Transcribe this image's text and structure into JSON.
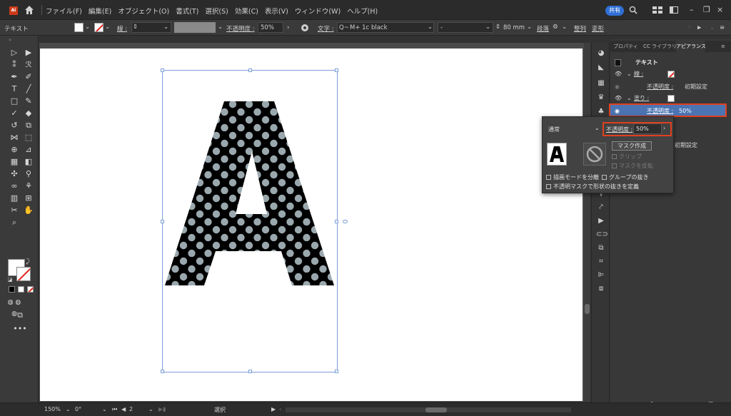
{
  "menubar": {
    "logo": "Ai",
    "items": [
      "ファイル(F)",
      "編集(E)",
      "オブジェクト(O)",
      "書式(T)",
      "選択(S)",
      "効果(C)",
      "表示(V)",
      "ウィンドウ(W)",
      "ヘルプ(H)"
    ],
    "share_label": "共有"
  },
  "controlbar": {
    "object_type": "テキスト",
    "stroke_label": "線 :",
    "opacity_label": "不透明度 :",
    "opacity_value": "50%",
    "char_label": "文字 :",
    "font_search_prefix": "Q~",
    "font_name": "M+ 1c black",
    "font_style": "-",
    "font_size": "80 mm",
    "paragraph_label": "段落",
    "align_label": "整列",
    "transform_label": "変形"
  },
  "panel": {
    "tabs": [
      "プロパティ",
      "CC ライブラリ",
      "アピアランス"
    ],
    "title": "テキスト",
    "stroke_label": "線 :",
    "stroke_opacity_label": "不透明度 :",
    "stroke_opacity_value": "初期設定",
    "fill_label": "塗り :",
    "fill_opacity_label": "不透明度 :",
    "fill_opacity_value": "50%",
    "default_opacity_value": "初期設定"
  },
  "popup": {
    "blend_mode": "通常",
    "opacity_label": "不透明度 :",
    "opacity_value": "50%",
    "mask_button": "マスク作成",
    "clip_label": "クリップ",
    "invert_mask_label": "マスクを反転",
    "isolate_label": "描画モードを分離",
    "knockout_label": "グループの抜き",
    "mask_define_label": "不透明マスクで形状の抜きを定義"
  },
  "statusbar": {
    "zoom": "150%",
    "rotation": "0°",
    "artboard_number": "2",
    "tool": "選択"
  },
  "artwork": {
    "letter": "A",
    "fill_color": "#000000",
    "dot_color": "#9aa8ae"
  },
  "colors": {
    "accent_selected": "#4c74b3",
    "highlight_box": "#e0401f",
    "share_button": "#2f6fd6"
  }
}
